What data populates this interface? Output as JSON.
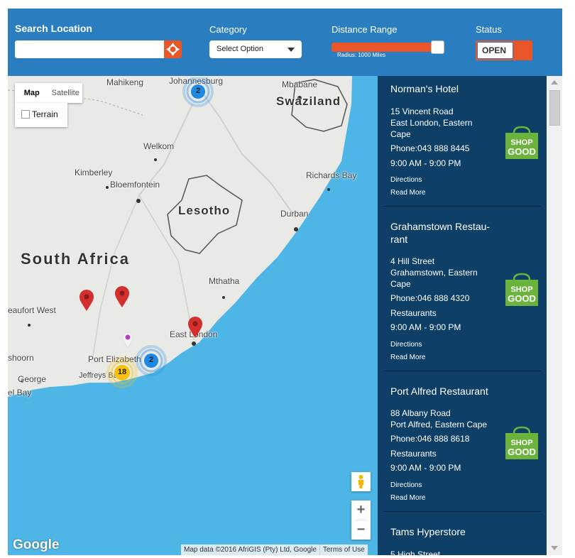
{
  "header": {
    "search_label": "Search Location",
    "search_value": "",
    "search_placeholder": "",
    "locate_icon": "crosshair-icon",
    "category_label": "Category",
    "category_selected": "Select Option",
    "distance_label": "Distance Range",
    "distance_fraction": 1.0,
    "radius_text": "Radius: 1000 Miles",
    "status_label": "Status",
    "status_value": "OPEN"
  },
  "map": {
    "type_options": [
      "Map",
      "Satellite"
    ],
    "active_type": "Map",
    "terrain_label": "Terrain",
    "places": {
      "johannesburg": "Johannesburg",
      "mahikeng": "Mahikeng",
      "mbabane": "Mbabane",
      "swaziland": "Swaziland",
      "welkom": "Welkom",
      "kimberley": "Kimberley",
      "bloemfontein": "Bloemfontein",
      "richards_bay": "Richards Bay",
      "lesotho": "Lesotho",
      "durban": "Durban",
      "south_africa": "South Africa",
      "mthatha": "Mthatha",
      "beaufort_west": "eaufort West",
      "east_london": "East London",
      "oudtshoorn": "shoorn",
      "port_elizabeth": "Port Elizabeth",
      "george": "George",
      "jeffreys_bay": "Jeffreys Ba",
      "mossel_bay": "el Bay"
    },
    "clusters": [
      "2",
      "2",
      "18"
    ],
    "zoom_in": "+",
    "zoom_out": "−",
    "logo": "Google",
    "attribution": "Map data ©2016 AfriGIS (Pty) Ltd, Google",
    "terms": "Terms of Use",
    "colors": {
      "water": "#4db6e6",
      "land": "#e9e9e6",
      "marker_red": "#d32f2f",
      "cluster_blue": "#1e88e5",
      "cluster_yellow": "#f9c10b"
    }
  },
  "stores": [
    {
      "name": "Norman's Hotel",
      "address1": "15 Vincent Road",
      "address2": "East London, Eastern",
      "address3": "Cape",
      "phone": "Phone:043 888 8445",
      "category": "",
      "hours": "9:00 AM - 9:00 PM",
      "directions": "Directions",
      "read_more": "Read More"
    },
    {
      "name": "Grahamstown Restau-rant",
      "address1": "4 Hill Street",
      "address2": "Grahamstown, Eastern",
      "address3": "Cape",
      "phone": "Phone:046 888 4320",
      "category": "Restaurants",
      "hours": "9:00 AM - 9:00 PM",
      "directions": "Directions",
      "read_more": "Read More"
    },
    {
      "name": "Port Alfred Restaurant",
      "address1": "88 Albany Road",
      "address2": "Port Alfred, Eastern Cape",
      "address3": "",
      "phone": "Phone:046 888 8618",
      "category": "Restaurants",
      "hours": "9:00 AM - 9:00 PM",
      "directions": "Directions",
      "read_more": "Read More"
    },
    {
      "name": "Tams Hyperstore",
      "address1": "5 High Street"
    }
  ],
  "store_logo": {
    "line1": "SHOP",
    "line2": "GOOD",
    "color": "#6cb33e"
  },
  "colors": {
    "header": "#2a7ec0",
    "accent": "#e8562a",
    "list_bg": "#0e3f66"
  }
}
